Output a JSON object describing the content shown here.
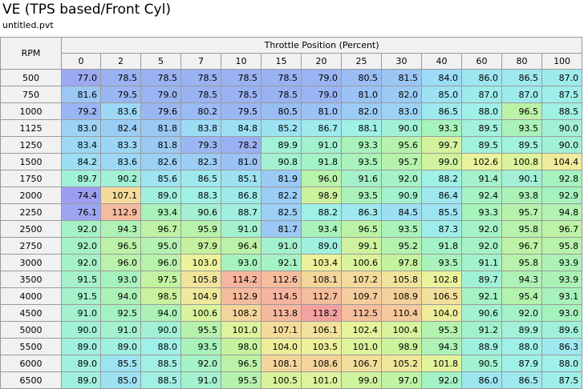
{
  "title": "VE (TPS based/Front Cyl)",
  "subtitle": "untitled.pvt",
  "table": {
    "row_axis_label": "RPM",
    "col_axis_label": "Throttle Position (Percent)",
    "columns": [
      "0",
      "2",
      "5",
      "7",
      "10",
      "15",
      "20",
      "25",
      "30",
      "40",
      "60",
      "80",
      "100"
    ],
    "rows": [
      {
        "rpm": "500",
        "values": [
          "77.0",
          "78.5",
          "78.5",
          "78.5",
          "78.5",
          "78.5",
          "79.0",
          "80.5",
          "81.5",
          "84.0",
          "86.0",
          "86.5",
          "87.0"
        ]
      },
      {
        "rpm": "750",
        "values": [
          "81.6",
          "79.5",
          "79.0",
          "78.5",
          "78.5",
          "78.5",
          "79.0",
          "81.0",
          "82.0",
          "85.0",
          "87.0",
          "87.0",
          "87.5"
        ]
      },
      {
        "rpm": "1000",
        "values": [
          "79.2",
          "83.6",
          "79.6",
          "80.2",
          "79.5",
          "80.5",
          "81.0",
          "82.0",
          "83.0",
          "86.5",
          "88.0",
          "96.5",
          "88.5"
        ]
      },
      {
        "rpm": "1125",
        "values": [
          "83.0",
          "82.4",
          "81.8",
          "83.8",
          "84.8",
          "85.2",
          "86.7",
          "88.1",
          "90.0",
          "93.3",
          "89.5",
          "93.5",
          "90.0"
        ]
      },
      {
        "rpm": "1250",
        "values": [
          "83.4",
          "83.3",
          "81.8",
          "79.3",
          "78.2",
          "89.9",
          "91.0",
          "93.3",
          "95.6",
          "99.7",
          "89.5",
          "89.5",
          "90.0"
        ]
      },
      {
        "rpm": "1500",
        "values": [
          "84.2",
          "83.6",
          "82.6",
          "82.3",
          "81.0",
          "90.8",
          "91.8",
          "93.5",
          "95.7",
          "99.0",
          "102.6",
          "100.8",
          "104.4"
        ]
      },
      {
        "rpm": "1750",
        "values": [
          "89.7",
          "90.2",
          "85.6",
          "86.5",
          "85.1",
          "81.9",
          "96.0",
          "91.6",
          "92.0",
          "88.2",
          "91.4",
          "90.1",
          "92.8"
        ]
      },
      {
        "rpm": "2000",
        "values": [
          "74.4",
          "107.1",
          "89.0",
          "88.3",
          "86.8",
          "82.2",
          "98.9",
          "93.5",
          "90.9",
          "86.4",
          "92.4",
          "93.8",
          "92.9"
        ]
      },
      {
        "rpm": "2250",
        "values": [
          "76.1",
          "112.9",
          "93.4",
          "90.6",
          "88.7",
          "82.5",
          "88.2",
          "86.3",
          "84.5",
          "85.5",
          "93.3",
          "95.7",
          "94.8"
        ]
      },
      {
        "rpm": "2500",
        "values": [
          "92.0",
          "94.3",
          "96.7",
          "95.9",
          "91.0",
          "81.7",
          "93.4",
          "96.5",
          "93.5",
          "87.3",
          "92.0",
          "95.8",
          "96.7"
        ]
      },
      {
        "rpm": "2750",
        "values": [
          "92.0",
          "96.5",
          "95.0",
          "97.9",
          "96.4",
          "91.0",
          "89.0",
          "99.1",
          "95.2",
          "91.8",
          "92.0",
          "96.7",
          "95.8"
        ]
      },
      {
        "rpm": "3000",
        "values": [
          "92.0",
          "96.0",
          "96.0",
          "103.0",
          "93.0",
          "92.1",
          "103.4",
          "100.6",
          "97.8",
          "93.5",
          "91.1",
          "95.8",
          "93.9"
        ]
      },
      {
        "rpm": "3500",
        "values": [
          "91.5",
          "93.0",
          "97.5",
          "105.8",
          "114.2",
          "112.6",
          "108.1",
          "107.2",
          "105.8",
          "102.8",
          "89.7",
          "94.3",
          "93.9"
        ]
      },
      {
        "rpm": "4000",
        "values": [
          "91.5",
          "94.0",
          "98.5",
          "104.9",
          "112.9",
          "114.5",
          "112.7",
          "109.7",
          "108.9",
          "106.5",
          "92.1",
          "95.4",
          "93.1"
        ]
      },
      {
        "rpm": "4500",
        "values": [
          "91.0",
          "92.5",
          "94.0",
          "100.6",
          "108.2",
          "113.8",
          "118.2",
          "112.5",
          "110.4",
          "104.0",
          "90.6",
          "92.0",
          "93.0"
        ]
      },
      {
        "rpm": "5000",
        "values": [
          "90.0",
          "91.0",
          "90.0",
          "95.5",
          "101.0",
          "107.1",
          "106.1",
          "102.4",
          "100.4",
          "95.3",
          "91.2",
          "89.9",
          "89.6"
        ]
      },
      {
        "rpm": "5500",
        "values": [
          "89.0",
          "89.0",
          "88.0",
          "93.5",
          "98.0",
          "104.0",
          "103.5",
          "101.0",
          "98.9",
          "94.3",
          "88.9",
          "88.0",
          "86.3"
        ]
      },
      {
        "rpm": "6000",
        "values": [
          "89.0",
          "85.5",
          "88.5",
          "92.0",
          "96.5",
          "108.1",
          "108.6",
          "106.7",
          "105.2",
          "101.8",
          "90.5",
          "87.9",
          "88.0"
        ]
      },
      {
        "rpm": "6500",
        "values": [
          "89.0",
          "85.0",
          "88.5",
          "91.0",
          "95.5",
          "100.5",
          "101.0",
          "99.0",
          "97.0",
          "92.0",
          "86.0",
          "86.5",
          "87.5"
        ]
      }
    ]
  },
  "color_scale": {
    "stops": [
      {
        "value": 74,
        "color": "#9b9bf0"
      },
      {
        "value": 80,
        "color": "#9ab9f3"
      },
      {
        "value": 84,
        "color": "#9cdcf6"
      },
      {
        "value": 88,
        "color": "#9ff0e8"
      },
      {
        "value": 93,
        "color": "#a6f2bd"
      },
      {
        "value": 98,
        "color": "#c6f29e"
      },
      {
        "value": 103,
        "color": "#ecf39c"
      },
      {
        "value": 107,
        "color": "#f4dc9c"
      },
      {
        "value": 112,
        "color": "#f5c09d"
      },
      {
        "value": 118,
        "color": "#f4a2a1"
      }
    ]
  }
}
